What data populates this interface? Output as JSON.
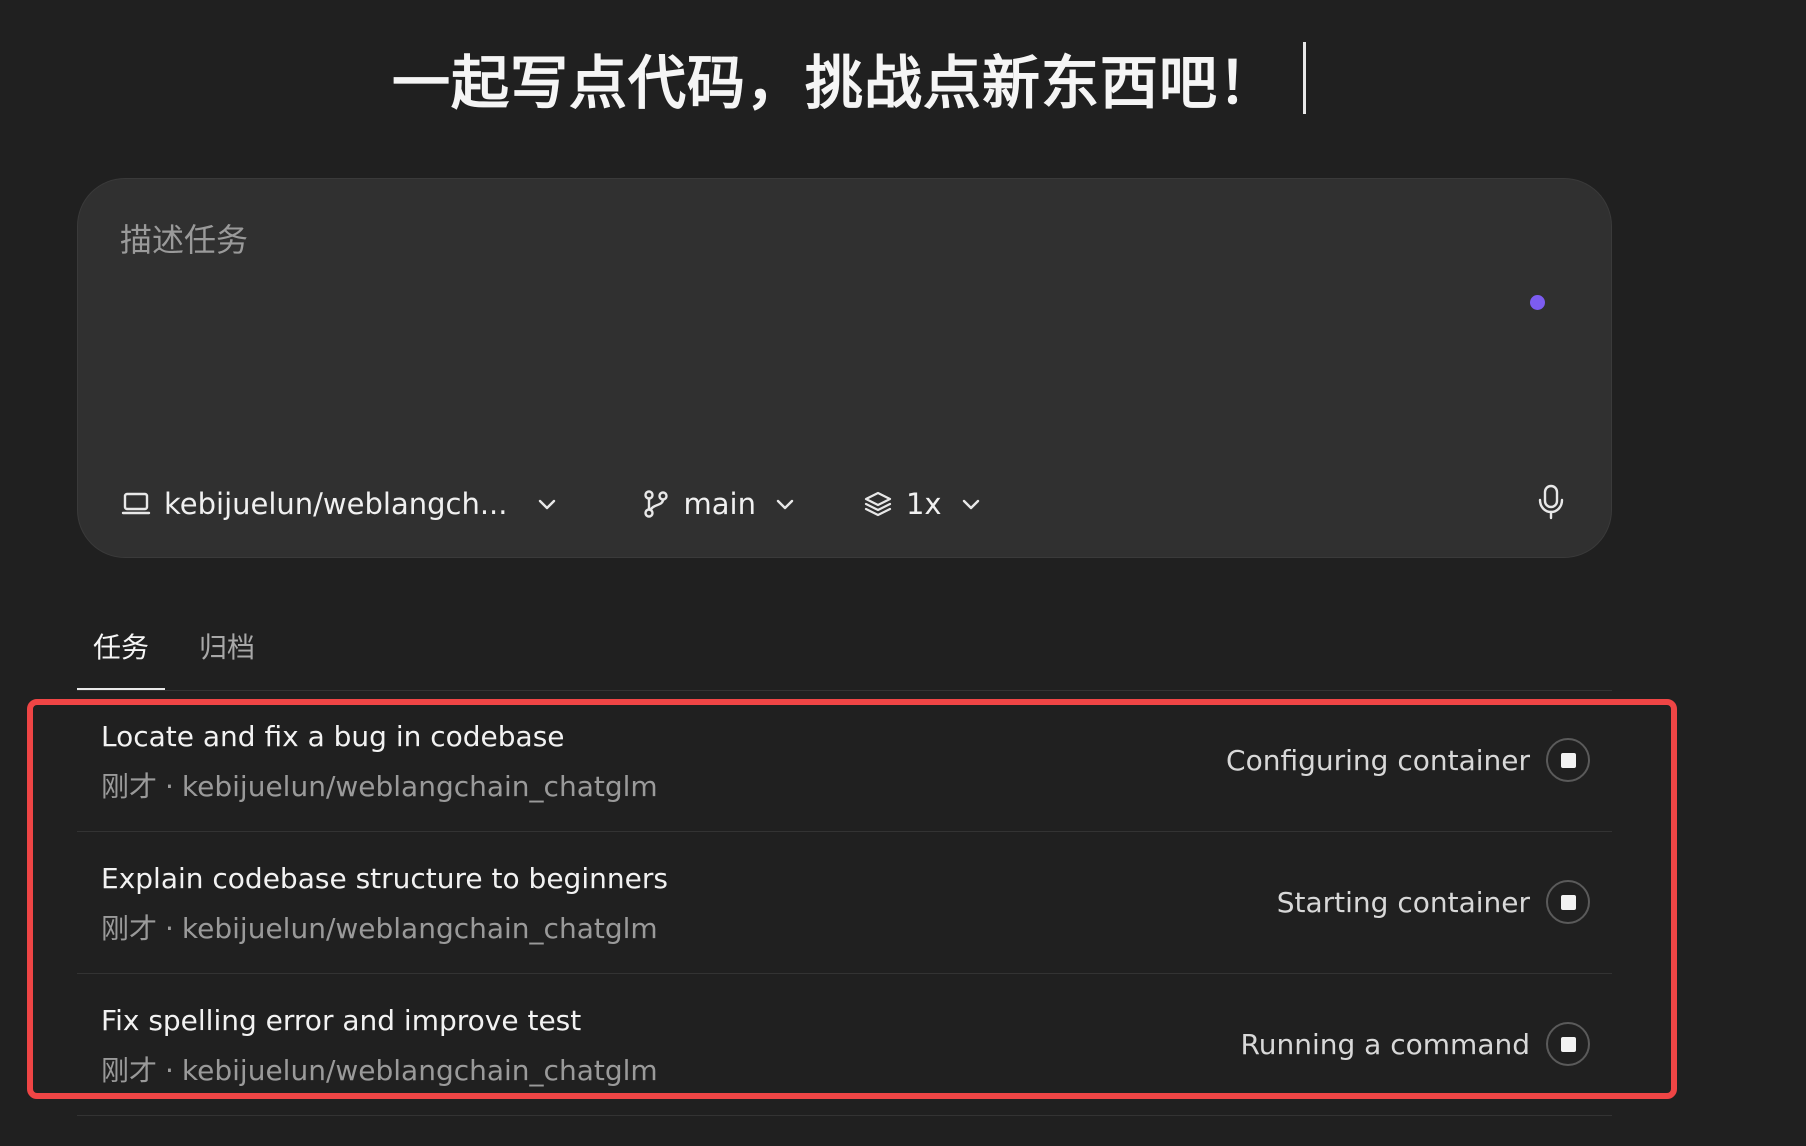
{
  "hero": {
    "title": "一起写点代码，挑战点新东西吧！"
  },
  "composer": {
    "placeholder": "描述任务",
    "repo": {
      "label": "kebijuelun/weblangch...",
      "icon": "laptop-icon"
    },
    "branch": {
      "label": "main",
      "icon": "git-branch-icon"
    },
    "versions": {
      "label": "1x",
      "icon": "layers-icon"
    },
    "mic_icon": "microphone-icon",
    "dot_color": "#7c5cf0"
  },
  "tabs": [
    {
      "label": "任务",
      "active": true
    },
    {
      "label": "归档",
      "active": false
    }
  ],
  "tasks": [
    {
      "title": "Locate and fix a bug in codebase",
      "time": "刚才",
      "separator": "·",
      "repo": "kebijuelun/weblangchain_chatglm",
      "status": "Configuring container"
    },
    {
      "title": "Explain codebase structure to beginners",
      "time": "刚才",
      "separator": "·",
      "repo": "kebijuelun/weblangchain_chatglm",
      "status": "Starting container"
    },
    {
      "title": "Fix spelling error and improve test",
      "time": "刚才",
      "separator": "·",
      "repo": "kebijuelun/weblangchain_chatglm",
      "status": "Running a command"
    }
  ],
  "annotation": {
    "highlight_color": "#ef4545"
  }
}
